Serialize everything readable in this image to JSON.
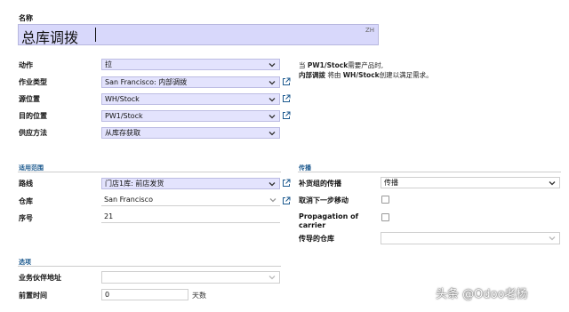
{
  "name_label": "名称",
  "name_value": "总库调拨",
  "lang_badge": "ZH",
  "fields": {
    "action": {
      "label": "动作",
      "value": "拉"
    },
    "op_type": {
      "label": "作业类型",
      "value": "San Francisco: 内部调拨"
    },
    "src_loc": {
      "label": "源位置",
      "value": "WH/Stock"
    },
    "dest_loc": {
      "label": "目的位置",
      "value": "PW1/Stock"
    },
    "supply": {
      "label": "供应方法",
      "value": "从库存获取"
    }
  },
  "note": {
    "line1_prefix": "当 ",
    "line1_bold": "PW1/Stock",
    "line1_suffix": "需要产品时,",
    "line2_bold1": "内部调拨",
    "line2_mid": " 将由 ",
    "line2_bold2": "WH/Stock",
    "line2_suffix": "创建以满足需求。"
  },
  "scope_section": {
    "title": "适用范围",
    "route": {
      "label": "路线",
      "value": "门店1库: 前店发货"
    },
    "warehouse": {
      "label": "仓库",
      "value": "San Francisco"
    },
    "seq": {
      "label": "序号",
      "value": "21"
    }
  },
  "propagation_section": {
    "title": "传播",
    "group": {
      "label": "补货组的传播",
      "value": "传播"
    },
    "cancel_next": {
      "label": "取消下一步移动"
    },
    "carrier": {
      "label_line1": "Propagation of",
      "label_line2": "carrier"
    },
    "warehouse": {
      "label": "传导的仓库"
    }
  },
  "options_section": {
    "title": "选项",
    "partner": {
      "label": "业务伙伴地址"
    },
    "lead": {
      "label": "前置时间",
      "value": "0",
      "unit": "天数"
    }
  },
  "watermark": "头条 @Odoo老杨",
  "colors": {
    "selected_field": "#e3e3fd",
    "section_title": "#1d5a8f",
    "link_icon": "#1d5a8f"
  }
}
